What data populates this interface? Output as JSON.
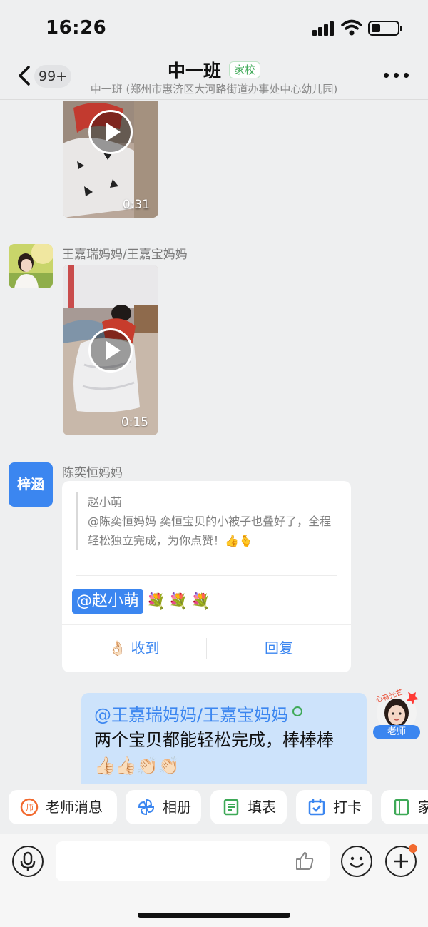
{
  "status": {
    "time": "16:26"
  },
  "header": {
    "unread": "99+",
    "title": "中一班",
    "tag": "家校",
    "subtitle": "中一班 (郑州市惠济区大河路街道办事处中心幼儿园)"
  },
  "messages": [
    {
      "type": "video",
      "duration": "0:31"
    },
    {
      "type": "video",
      "sender": "王嘉瑞妈妈/王嘉宝妈妈",
      "duration": "0:15"
    },
    {
      "type": "reply_card",
      "avatar_text": "梓涵",
      "sender": "陈奕恒妈妈",
      "quote_author": "赵小萌",
      "quote_text": "@陈奕恒妈妈 奕恒宝贝的小被子也叠好了，全程轻松独立完成，为你点赞！👍🫰",
      "mention": "@赵小萌",
      "emojis": "💐💐💐",
      "actions": {
        "ok": "👌🏻 收到",
        "reply": "回复"
      }
    },
    {
      "type": "mine",
      "mention": "@王嘉瑞妈妈/王嘉宝妈妈",
      "text": "两个宝贝都能轻松完成，棒棒棒👍🏻👍🏻👏🏻👏🏻",
      "avatar_badge": "老师",
      "avatar_sticker": "心有光芒"
    }
  ],
  "quick_actions": [
    {
      "label": "老师消息",
      "icon": "teacher-icon"
    },
    {
      "label": "相册",
      "icon": "pinwheel-icon"
    },
    {
      "label": "填表",
      "icon": "form-icon"
    },
    {
      "label": "打卡",
      "icon": "calendar-check-icon"
    },
    {
      "label": "家",
      "icon": "book-icon"
    }
  ],
  "colors": {
    "accent": "#3b86f0",
    "green": "#3ea957",
    "orange": "#f26a2f"
  }
}
